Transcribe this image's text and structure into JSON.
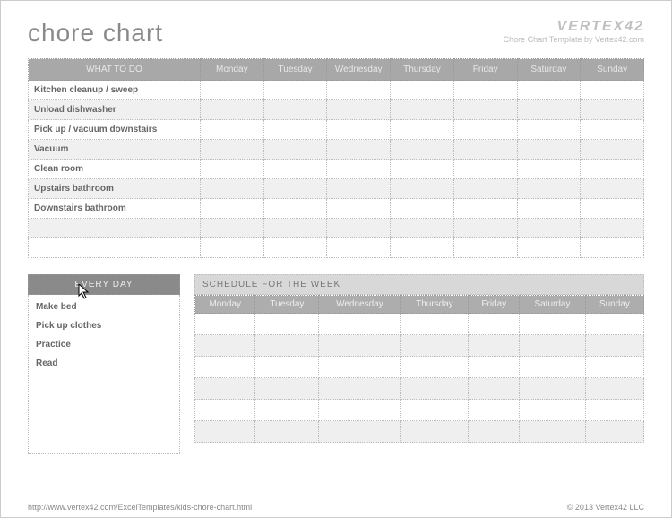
{
  "title": "chore chart",
  "brand": {
    "logo": "VERTEX42",
    "sub": "Chore Chart Template by Vertex42.com"
  },
  "main": {
    "header_label": "WHAT TO DO",
    "days": [
      "Monday",
      "Tuesday",
      "Wednesday",
      "Thursday",
      "Friday",
      "Saturday",
      "Sunday"
    ],
    "rows": [
      "Kitchen cleanup / sweep",
      "Unload dishwasher",
      "Pick up / vacuum downstairs",
      "Vacuum",
      "Clean room",
      "Upstairs bathroom",
      "Downstairs bathroom",
      "",
      ""
    ]
  },
  "every_day": {
    "header": "EVERY DAY",
    "items": [
      "Make bed",
      "Pick up clothes",
      "Practice",
      "Read"
    ]
  },
  "schedule": {
    "header": "SCHEDULE FOR THE WEEK",
    "days": [
      "Monday",
      "Tuesday",
      "Wednesday",
      "Thursday",
      "Friday",
      "Saturday",
      "Sunday"
    ],
    "rows": 6
  },
  "footer": {
    "url": "http://www.vertex42.com/ExcelTemplates/kids-chore-chart.html",
    "copyright": "© 2013 Vertex42 LLC"
  }
}
